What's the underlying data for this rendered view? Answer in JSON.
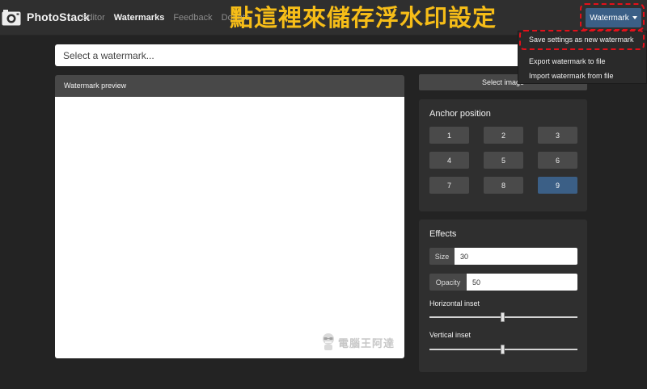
{
  "brand": {
    "name": "PhotoStack",
    "logo_icon": "camera-icon"
  },
  "nav": {
    "links": [
      {
        "label": "Editor",
        "active": false
      },
      {
        "label": "Watermarks",
        "active": true
      },
      {
        "label": "Feedback",
        "active": false
      },
      {
        "label": "Donate",
        "active": false
      }
    ]
  },
  "annotation": {
    "text": "點這裡來儲存浮水印設定",
    "color": "#f6bd18",
    "highlight_color": "#e3101a"
  },
  "watermark_menu": {
    "button_label": "Watermark",
    "items": [
      "Save settings as new watermark",
      "Export watermark to file",
      "Import watermark from file"
    ]
  },
  "search": {
    "placeholder": "Select a watermark..."
  },
  "preview": {
    "title": "Watermark preview",
    "logo_text": "電腦王阿達"
  },
  "select_image": {
    "label": "Select image"
  },
  "anchor": {
    "title": "Anchor position",
    "positions": [
      "1",
      "2",
      "3",
      "4",
      "5",
      "6",
      "7",
      "8",
      "9"
    ],
    "selected": "9"
  },
  "effects": {
    "title": "Effects",
    "size": {
      "label": "Size",
      "value": "30"
    },
    "opacity": {
      "label": "Opacity",
      "value": "50"
    },
    "horizontal_inset": {
      "label": "Horizontal inset",
      "value": 0.5
    },
    "vertical_inset": {
      "label": "Vertical inset",
      "value": 0.5
    }
  },
  "colors": {
    "accent": "#3b5f86",
    "background": "#232323",
    "panel": "#2f2f2f"
  }
}
